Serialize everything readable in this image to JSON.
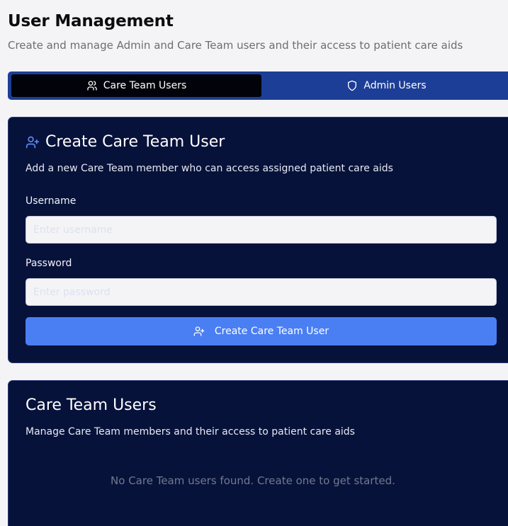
{
  "header": {
    "title": "User Management",
    "subtitle": "Create and manage Admin and Care Team users and their access to patient care aids"
  },
  "tabs": [
    {
      "label": "Care Team Users",
      "icon": "users-icon",
      "active": true
    },
    {
      "label": "Admin Users",
      "icon": "shield-icon",
      "active": false
    }
  ],
  "create_card": {
    "title": "Create Care Team User",
    "title_icon": "user-plus-icon",
    "description": "Add a new Care Team member who can access assigned patient care aids",
    "username_label": "Username",
    "username_placeholder": "Enter username",
    "username_value": "",
    "password_label": "Password",
    "password_placeholder": "Enter password",
    "password_value": "",
    "submit_label": "Create Care Team User",
    "submit_icon": "user-plus-icon"
  },
  "list_card": {
    "title": "Care Team Users",
    "description": "Manage Care Team members and their access to patient care aids",
    "empty_message": "No Care Team users found. Create one to get started."
  },
  "colors": {
    "background": "#f4f4f6",
    "tab_bar": "#1d3e96",
    "tab_active": "#02030a",
    "card_bg": "#07123a",
    "accent": "#4a7ff3",
    "title_icon": "#5b8bf5"
  }
}
